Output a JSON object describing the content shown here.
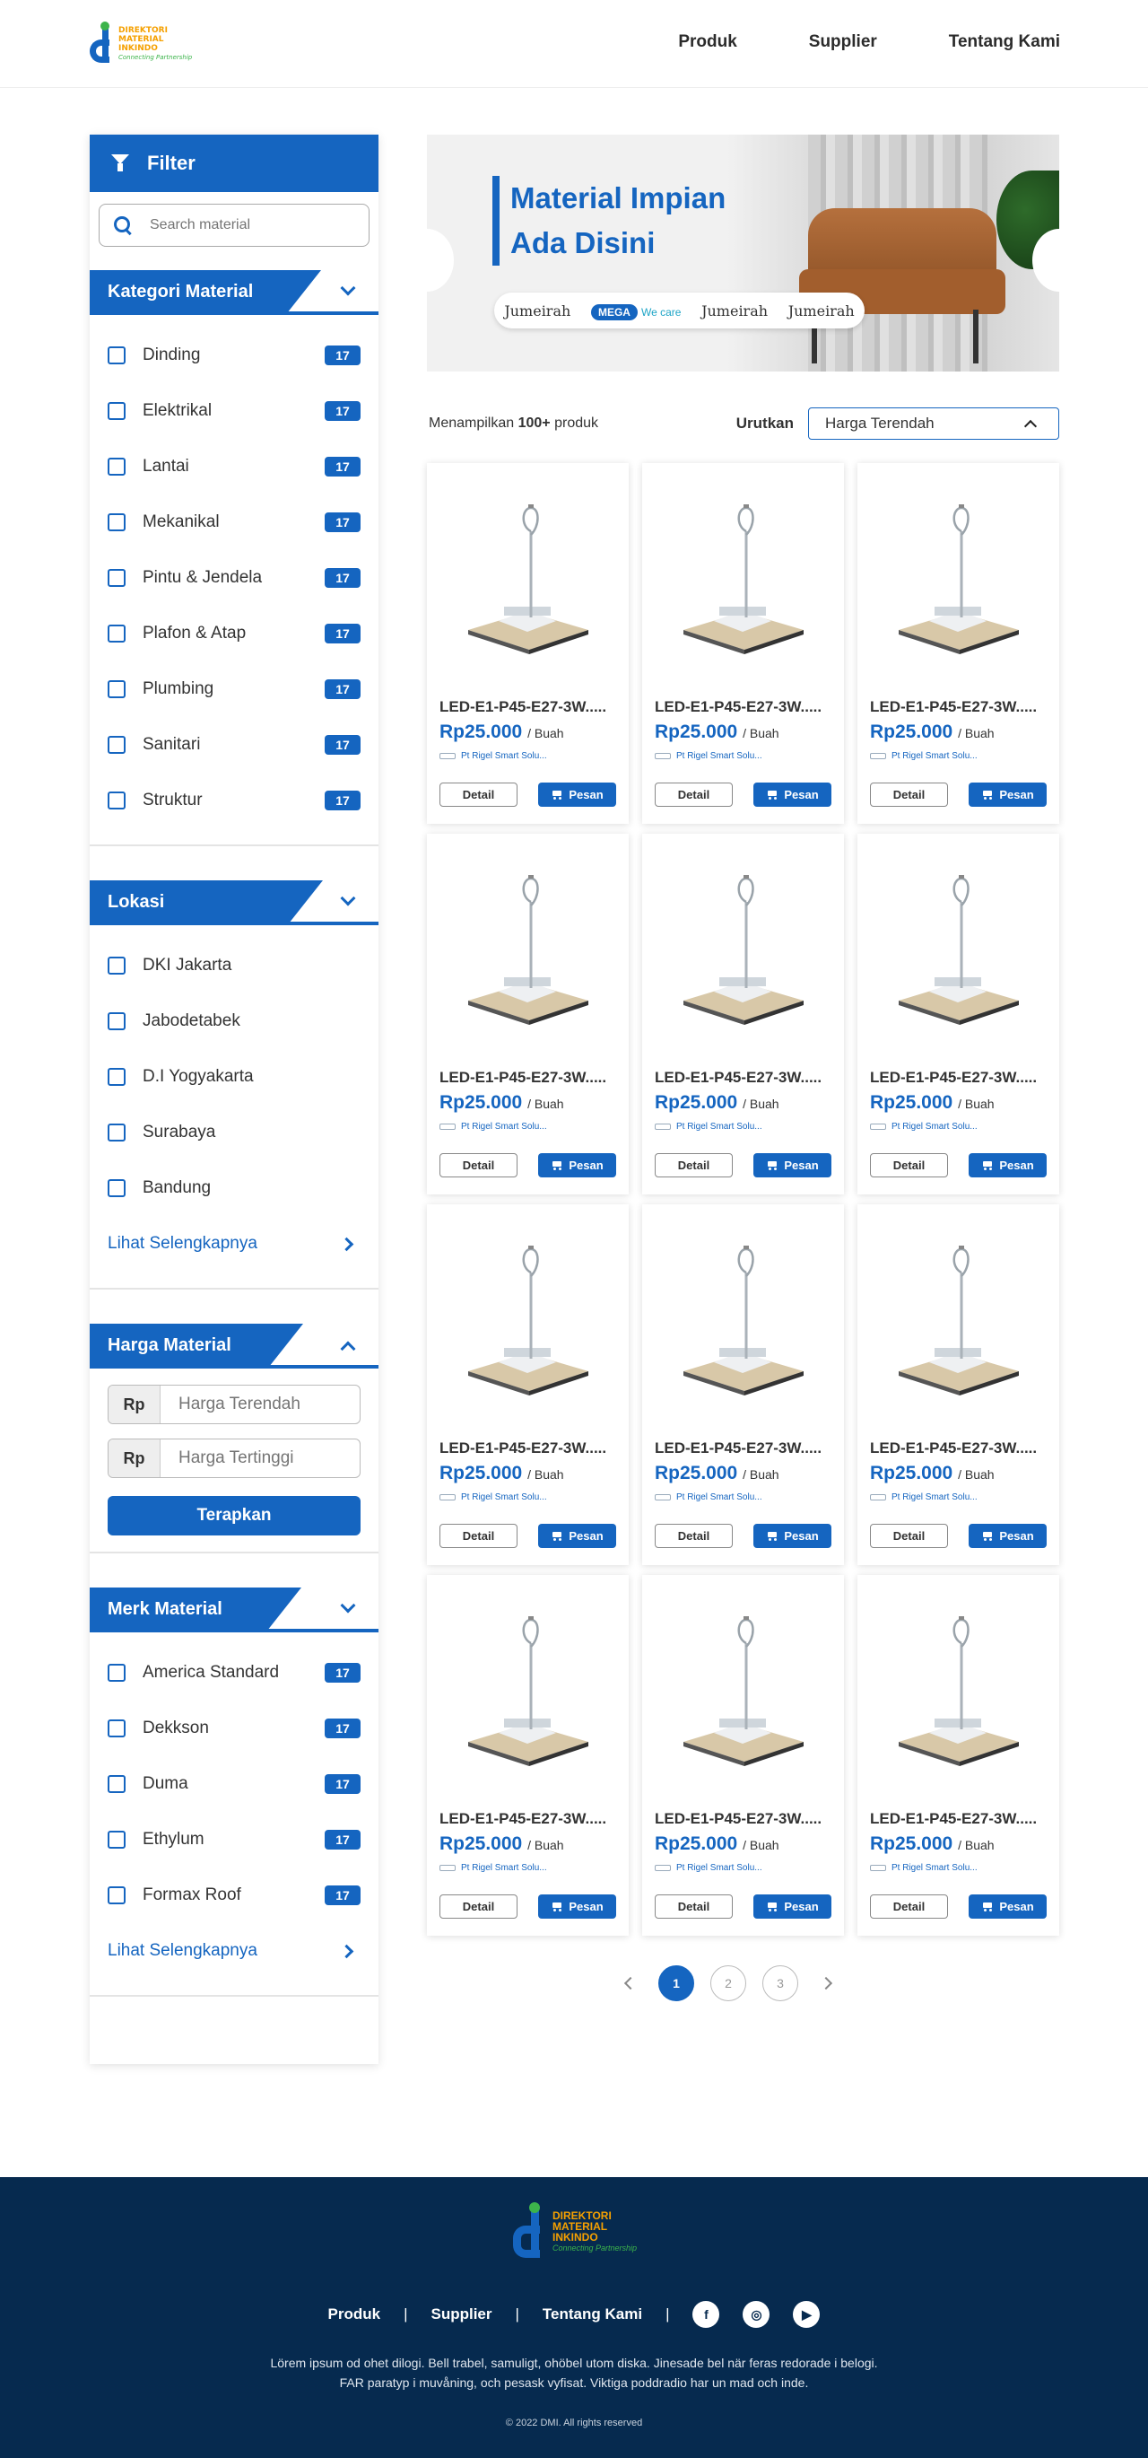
{
  "header": {
    "logo": {
      "line1": "DIREKTORI",
      "line2": "MATERIAL",
      "line3": "INKINDO",
      "tagline": "Connecting Partnership"
    },
    "nav": [
      "Produk",
      "Supplier",
      "Tentang Kami"
    ]
  },
  "sidebar": {
    "title": "Filter",
    "search_placeholder": "Search material",
    "kategori": {
      "title": "Kategori Material",
      "items": [
        {
          "label": "Dinding",
          "count": "17"
        },
        {
          "label": "Elektrikal",
          "count": "17"
        },
        {
          "label": "Lantai",
          "count": "17"
        },
        {
          "label": "Mekanikal",
          "count": "17"
        },
        {
          "label": "Pintu & Jendela",
          "count": "17"
        },
        {
          "label": "Plafon & Atap",
          "count": "17"
        },
        {
          "label": "Plumbing",
          "count": "17"
        },
        {
          "label": "Sanitari",
          "count": "17"
        },
        {
          "label": "Struktur",
          "count": "17"
        }
      ]
    },
    "lokasi": {
      "title": "Lokasi",
      "items": [
        "DKI Jakarta",
        "Jabodetabek",
        "D.I Yogyakarta",
        "Surabaya",
        "Bandung"
      ],
      "more": "Lihat Selengkapnya"
    },
    "harga": {
      "title": "Harga Material",
      "currency": "Rp",
      "min_placeholder": "Harga Terendah",
      "max_placeholder": "Harga Tertinggi",
      "apply": "Terapkan"
    },
    "merk": {
      "title": "Merk Material",
      "items": [
        {
          "label": "America Standard",
          "count": "17"
        },
        {
          "label": "Dekkson",
          "count": "17"
        },
        {
          "label": "Duma",
          "count": "17"
        },
        {
          "label": "Ethylum",
          "count": "17"
        },
        {
          "label": "Formax Roof",
          "count": "17"
        }
      ],
      "more": "Lihat Selengkapnya"
    }
  },
  "banner": {
    "line1": "Material Impian",
    "line2": "Ada Disini",
    "brands": [
      "Jumeirah",
      "MEGA",
      "We care",
      "Jumeirah",
      "Jumeirah"
    ]
  },
  "toolbar": {
    "showing_prefix": "Menampilkan",
    "showing_count": "100+",
    "showing_suffix": "produk",
    "sort_label": "Urutkan",
    "sort_value": "Harga Terendah"
  },
  "product": {
    "name": "LED-E1-P45-E27-3W.....",
    "price": "Rp25.000",
    "unit": "/ Buah",
    "supplier": "Pt Rigel Smart Solu...",
    "detail": "Detail",
    "order": "Pesan"
  },
  "pagination": {
    "pages": [
      "1",
      "2",
      "3"
    ],
    "active": "1"
  },
  "footer": {
    "nav": [
      "Produk",
      "Supplier",
      "Tentang Kami"
    ],
    "separator": "|",
    "social": [
      "f",
      "◎",
      "▶"
    ],
    "text1": "Lörem ipsum od ohet dilogi. Bell trabel, samuligt, ohöbel utom diska. Jinesade bel när feras redorade i belogi.",
    "text2": "FAR paratyp i muvåning, och pesask vyfisat. Viktiga poddradio har un mad och inde.",
    "copyright": "© 2022 DMI. All rights reserved"
  },
  "colors": {
    "primary": "#1565c0",
    "footer_bg": "#062a4f",
    "logo_orange": "#f5a000",
    "logo_green": "#3cb44b"
  }
}
